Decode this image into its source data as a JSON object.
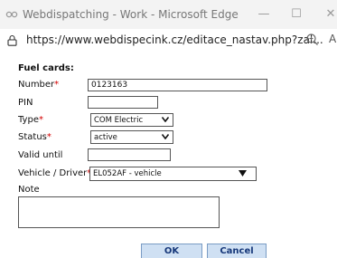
{
  "window": {
    "title": "Webdispatching - Work - Microsoft Edge",
    "minimize_glyph": "—",
    "maximize_glyph": "☐",
    "close_glyph": "✕"
  },
  "address_bar": {
    "url": "https://www.webdispecink.cz/editace_nastav.php?zal..."
  },
  "form": {
    "section_title": "Fuel cards:",
    "required_mark": "*",
    "number": {
      "label": "Number",
      "value": "0123163"
    },
    "pin": {
      "label": "PIN",
      "value": ""
    },
    "type": {
      "label": "Type",
      "value": "COM Electric"
    },
    "status": {
      "label": "Status",
      "value": "active"
    },
    "valid_until": {
      "label": "Valid until",
      "value": ""
    },
    "vehicle_driver": {
      "label": "Vehicle / Driver",
      "value": "EL052AF - vehicle"
    },
    "note": {
      "label": "Note",
      "value": ""
    }
  },
  "buttons": {
    "ok": "OK",
    "cancel": "Cancel"
  },
  "colors": {
    "required": "#d40000",
    "button_bg": "#cfe0f3",
    "button_text": "#17387a"
  },
  "icons": [
    "edge-app-icon",
    "lock-icon",
    "zoom-icon",
    "dropdown-arrow-icon"
  ]
}
